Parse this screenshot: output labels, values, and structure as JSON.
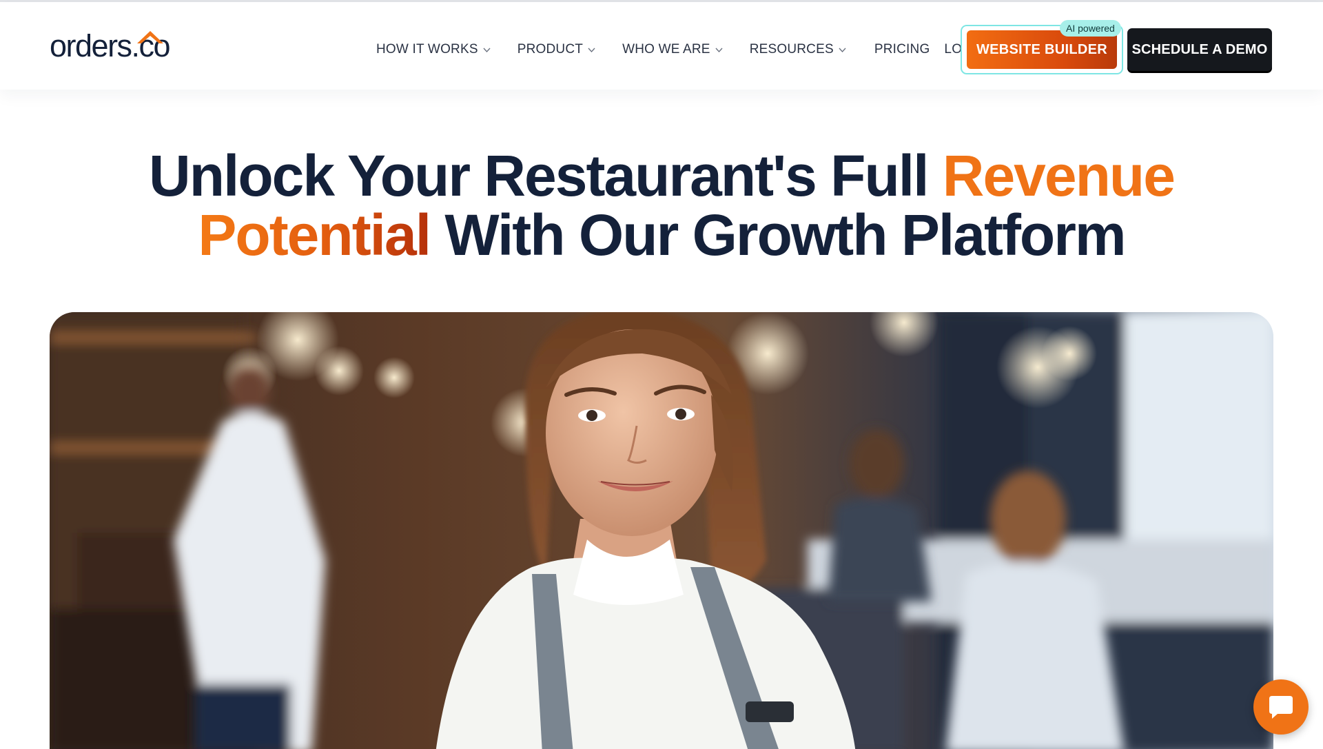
{
  "brand": {
    "logo_text": "orders.co",
    "colors": {
      "accent": "#f07316",
      "accent_dark": "#b93a0a",
      "navy": "#14213a",
      "ai_badge_bg": "#a7efe9",
      "demo_bg": "#15181d"
    }
  },
  "nav": {
    "items": [
      {
        "label": "HOW IT WORKS",
        "has_dropdown": true
      },
      {
        "label": "PRODUCT",
        "has_dropdown": true
      },
      {
        "label": "WHO WE ARE",
        "has_dropdown": true
      },
      {
        "label": "RESOURCES",
        "has_dropdown": true
      },
      {
        "label": "PRICING",
        "has_dropdown": false
      },
      {
        "label": "LOGIN",
        "has_dropdown": false
      }
    ],
    "dropdown_icon": "chevron-down-icon"
  },
  "cta": {
    "website_builder_label": "WEBSITE BUILDER",
    "ai_badge": "AI powered",
    "schedule_demo_label": "SCHEDULE A DEMO"
  },
  "hero": {
    "title_part_1": "Unlock Your Restaurant's Full ",
    "title_accent_1": "Revenue",
    "title_accent_2": "Potential",
    "title_part_2": " With Our Growth Platform",
    "image_icon": "hero-photo-restaurant-staff"
  },
  "chat": {
    "icon": "chat-bubble-icon"
  }
}
